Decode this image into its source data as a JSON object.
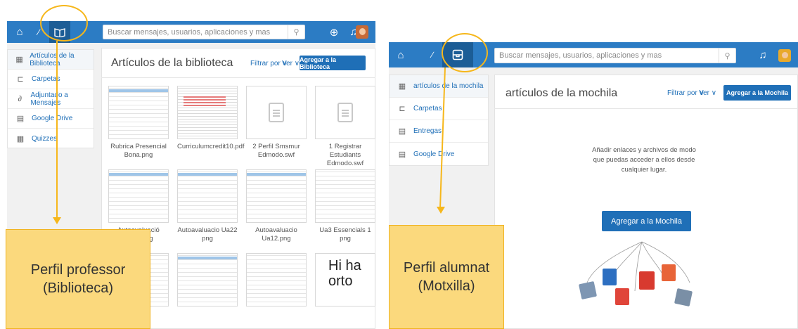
{
  "left_panel": {
    "search_placeholder": "Buscar mensajes, usuarios, aplicaciones y mas",
    "sidebar": [
      {
        "label": "Artículos de la Biblioteca",
        "icon": "library-icon"
      },
      {
        "label": "Carpetas",
        "icon": "folder-icon"
      },
      {
        "label": "Adjuntado a Mensajes",
        "icon": "paperclip-icon"
      },
      {
        "label": "Google Drive",
        "icon": "drive-icon"
      },
      {
        "label": "Quizzes",
        "icon": "quiz-icon"
      }
    ],
    "title": "Artículos de la biblioteca",
    "filter_label": "Filtrar por ∨",
    "view_label": "Ver ∨",
    "add_button": "Agregar a la Biblioteca",
    "files": [
      {
        "name": "Rubrica Presencial Bona.png"
      },
      {
        "name": "Curriculumcredit10.pdf"
      },
      {
        "name": "2 Perfil Smsmur Edmodo.swf"
      },
      {
        "name": "1 Registrar Estudiants Edmodo.swf"
      },
      {
        "name": "Autoavaluació Ua22.png"
      },
      {
        "name": "Autoavaluacio Ua22 png"
      },
      {
        "name": "Autoavaluacio Ua12.png"
      },
      {
        "name": "Ua3 Essencials 1 png"
      }
    ],
    "callout": "Perfil professor (Biblioteca)",
    "thumb_text_1": "Hi ha",
    "thumb_text_2": "orto"
  },
  "right_panel": {
    "search_placeholder": "Buscar mensajes, usuarios, aplicaciones y mas",
    "sidebar": [
      {
        "label": "artículos de la mochila",
        "icon": "backpack-icon"
      },
      {
        "label": "Carpetas",
        "icon": "folder-icon"
      },
      {
        "label": "Entregas",
        "icon": "submission-icon"
      },
      {
        "label": "Google Drive",
        "icon": "drive-icon"
      }
    ],
    "title": "artículos de la mochila",
    "filter_label": "Filtrar por ∨",
    "view_label": "Ver ∨",
    "add_button": "Agregar a la Mochila",
    "empty_message": "Añadir enlaces y archivos de modo que puedas acceder a ellos desde cualquier lugar.",
    "big_button": "Agregar a la Mochila",
    "callout": "Perfil alumnat (Motxilla)"
  },
  "colors": {
    "topbar": "#2c7cc4",
    "accent": "#1f6fb7",
    "callout": "#fbd97d",
    "highlight": "#f6b71b"
  }
}
